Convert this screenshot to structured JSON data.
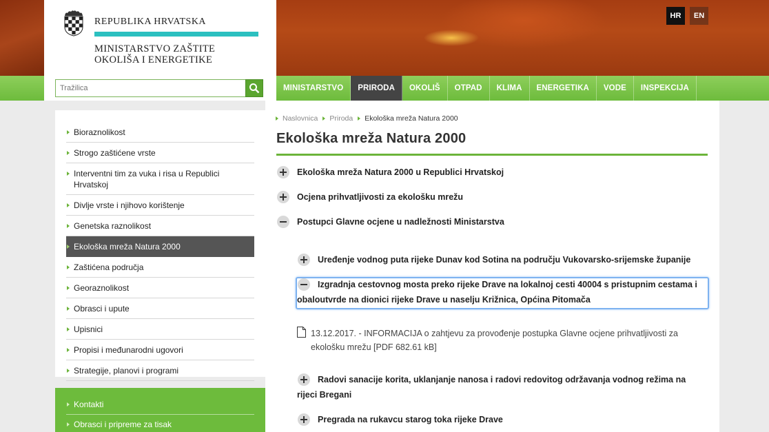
{
  "header": {
    "republic": "REPUBLIKA HRVATSKA",
    "ministry_line1": "MINISTARSTVO ZAŠTITE",
    "ministry_line2": "OKOLIŠA I ENERGETIKE",
    "search_placeholder": "Tražilica",
    "languages": [
      "HR",
      "EN"
    ]
  },
  "nav": {
    "items": [
      "MINISTARSTVO",
      "PRIRODA",
      "OKOLIŠ",
      "OTPAD",
      "KLIMA",
      "ENERGETIKA",
      "VODE",
      "INSPEKCIJA"
    ],
    "active": "PRIRODA"
  },
  "sidebar": {
    "items": [
      "Bioraznolikost",
      "Strogo zaštićene vrste",
      "Interventni tim za vuka i risa u Republici Hrvatskoj",
      "Divlje vrste i njihovo korištenje",
      "Genetska raznolikost",
      "Ekološka mreža Natura 2000",
      "Zaštićena područja",
      "Georaznolikost",
      "Obrasci i upute",
      "Upisnici",
      "Propisi i međunarodni ugovori",
      "Strategije, planovi i programi"
    ],
    "active": "Ekološka mreža Natura 2000",
    "secondary": [
      "Kontakti",
      "Obrasci i pripreme za tisak"
    ]
  },
  "breadcrumb": [
    "Naslovnica",
    "Priroda",
    "Ekološka mreža Natura 2000"
  ],
  "main": {
    "title": "Ekološka mreža Natura 2000",
    "accordion": [
      "Ekološka mreža Natura 2000 u Republici Hrvatskoj",
      "Ocjena prihvatljivosti za ekološku mrežu",
      "Postupci Glavne ocjene u nadležnosti Ministarstva"
    ],
    "subaccordion": [
      "Uređenje vodnog puta rijeke Dunav kod Sotina na području Vukovarsko-srijemske županije",
      "Izgradnja cestovnog mosta preko rijeke Drave na lokalnoj cesti 40004 s pristupnim cestama i obaloutvrde na dionici rijeke Drave u naselju Križnica, Općina Pitomača",
      "Radovi sanacije korita, uklanjanje nanosa i radovi redovitog održavanja vodnog režima na rijeci Bregani",
      "Pregrada na rukavcu starog toka rijeke Drave"
    ],
    "document": "13.12.2017. - INFORMACIJA o zahtjevu za provođenje postupka Glavne ocjene prihvatljivosti za ekološku mrežu [PDF 682.61 kB]"
  }
}
